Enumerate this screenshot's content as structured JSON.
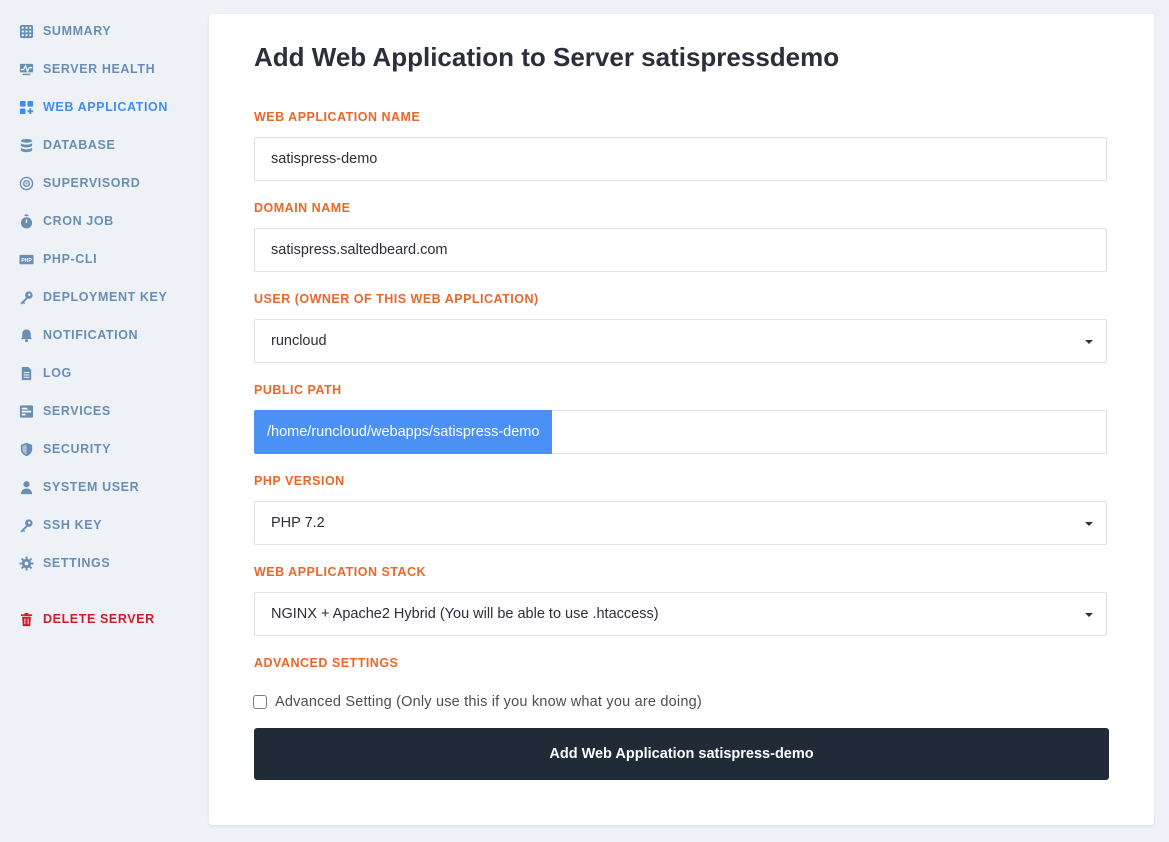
{
  "sidebar": {
    "items": [
      {
        "label": "SUMMARY",
        "icon": "summary-grid-icon"
      },
      {
        "label": "SERVER HEALTH",
        "icon": "monitor-icon"
      },
      {
        "label": "WEB APPLICATION",
        "icon": "apps-grid-icon",
        "active": true
      },
      {
        "label": "DATABASE",
        "icon": "database-icon"
      },
      {
        "label": "SUPERVISORD",
        "icon": "gear-circle-icon"
      },
      {
        "label": "CRON JOB",
        "icon": "stopwatch-icon"
      },
      {
        "label": "PHP-CLI",
        "icon": "php-icon"
      },
      {
        "label": "DEPLOYMENT KEY",
        "icon": "key-icon"
      },
      {
        "label": "NOTIFICATION",
        "icon": "bell-icon"
      },
      {
        "label": "LOG",
        "icon": "document-icon"
      },
      {
        "label": "SERVICES",
        "icon": "services-icon"
      },
      {
        "label": "SECURITY",
        "icon": "shield-icon"
      },
      {
        "label": "SYSTEM USER",
        "icon": "user-icon"
      },
      {
        "label": "SSH KEY",
        "icon": "key-icon"
      },
      {
        "label": "SETTINGS",
        "icon": "gear-icon"
      }
    ],
    "delete": {
      "label": "DELETE SERVER",
      "icon": "trash-icon"
    }
  },
  "form": {
    "title": "Add Web Application to Server satispressdemo",
    "app_name": {
      "label": "WEB APPLICATION NAME",
      "value": "satispress-demo"
    },
    "domain": {
      "label": "DOMAIN NAME",
      "value": "satispress.saltedbeard.com"
    },
    "user": {
      "label": "USER (OWNER OF THIS WEB APPLICATION)",
      "value": "runcloud"
    },
    "public_path": {
      "label": "PUBLIC PATH",
      "prefix": "/home/runcloud/webapps/satispress-demo",
      "value": ""
    },
    "php_version": {
      "label": "PHP VERSION",
      "value": "PHP 7.2"
    },
    "stack": {
      "label": "WEB APPLICATION STACK",
      "value": "NGINX + Apache2 Hybrid (You will be able to use .htaccess)"
    },
    "advanced": {
      "label": "ADVANCED SETTINGS",
      "checkbox_label": "Advanced Setting (Only use this if you know what you are doing)",
      "checked": false
    },
    "submit_label": "Add Web Application satispress-demo"
  },
  "colors": {
    "accent": "#3f8ef0",
    "label_orange": "#e8682a",
    "sidebar_text": "#6a8eb3",
    "danger": "#c8202a",
    "button_dark": "#212b37"
  }
}
